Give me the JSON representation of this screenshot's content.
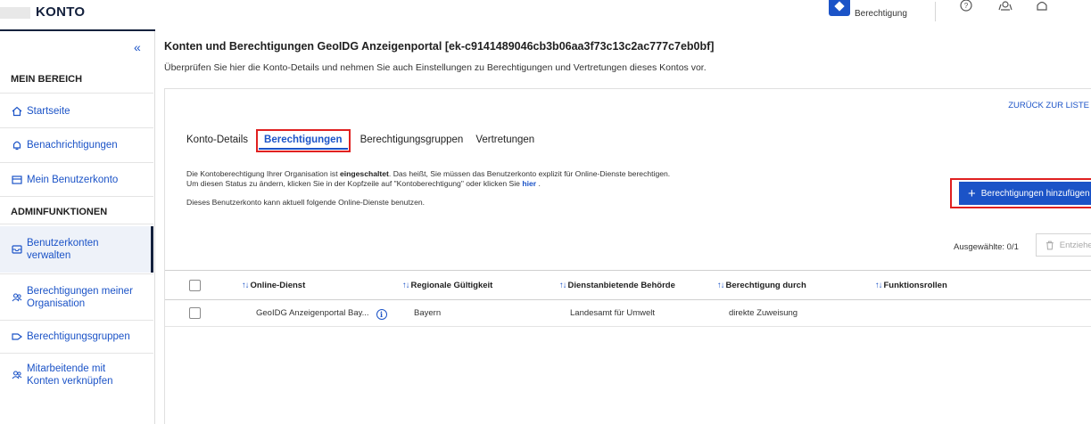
{
  "header": {
    "brand": "KONTO",
    "permission_label": "Berechtigung"
  },
  "sidebar": {
    "collapse_label": "«",
    "section_my_area": "MEIN BEREICH",
    "my_area_items": [
      {
        "label": "Startseite",
        "icon": "home-icon"
      },
      {
        "label": "Benachrichtigungen",
        "icon": "bell-icon"
      },
      {
        "label": "Mein Benutzerkonto",
        "icon": "account-card-icon"
      }
    ],
    "section_admin": "ADMINFUNKTIONEN",
    "admin_items": [
      {
        "label": "Benutzerkonten verwalten",
        "icon": "inbox-icon",
        "active": true
      },
      {
        "label": "Berechtigungen meiner Organisation",
        "icon": "users-icon"
      },
      {
        "label": "Berechtigungsgruppen",
        "icon": "tag-icon"
      },
      {
        "label": "Mitarbeitende mit Konten verknüpfen",
        "icon": "users-icon"
      }
    ]
  },
  "main": {
    "title": "Konten und Berechtigungen GeoIDG Anzeigenportal [ek-c9141489046cb3b06aa3f73c13c2ac777c7eb0bf]",
    "subtitle": "Überprüfen Sie hier die Konto-Details und nehmen Sie auch Einstellungen zu Berechtigungen und Vertretungen dieses Kontos vor.",
    "back_link": "ZURÜCK ZUR LISTE",
    "tabs": [
      {
        "label": "Konto-Details",
        "active": false
      },
      {
        "label": "Berechtigungen",
        "active": true
      },
      {
        "label": "Berechtigungsgruppen",
        "active": false
      },
      {
        "label": "Vertretungen",
        "active": false
      }
    ],
    "info_line1_pre": "Die Kontoberechtigung Ihrer Organisation ist ",
    "info_line1_bold": "eingeschaltet",
    "info_line1_post": ". Das heißt, Sie müssen das Benutzerkonto explizit für Online-Dienste berechtigen.",
    "info_line2_pre": "Um diesen Status zu ändern, klicken Sie in der Kopfzeile auf \"Kontoberechtigung\" oder klicken Sie ",
    "info_line2_link": "hier",
    "info_line2_post": " .",
    "info_line3": "Dieses Benutzerkonto kann aktuell folgende Online-Dienste benutzen.",
    "add_button": "Berechtigungen hinzufügen",
    "selected_label": "Ausgewählte: 0/1",
    "withdraw_button": "Entziehen",
    "table": {
      "columns": [
        "Online-Dienst",
        "Regionale Gültigkeit",
        "Dienstanbietende Behörde",
        "Berechtigung durch",
        "Funktionsrollen"
      ],
      "rows": [
        {
          "service": "GeoIDG Anzeigenportal Bay...",
          "region": "Bayern",
          "authority": "Landesamt für Umwelt",
          "granted_by": "direkte Zuweisung",
          "roles": ""
        }
      ]
    }
  },
  "colors": {
    "primary": "#1b53c7",
    "highlight": "#e02020",
    "navy": "#14213d"
  }
}
